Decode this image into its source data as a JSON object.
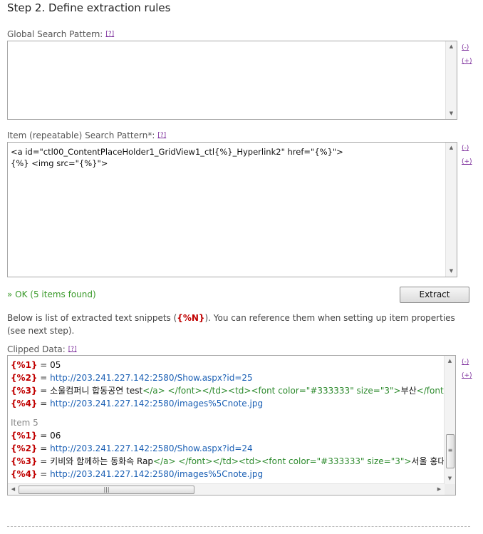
{
  "step_title": "Step 2. Define extraction rules",
  "help_link": "[?]",
  "global_pattern": {
    "label": "Global Search Pattern:",
    "value": ""
  },
  "item_pattern": {
    "label": "Item (repeatable) Search Pattern*:",
    "line1": "<a id=\"ctl00_ContentPlaceHolder1_GridView1_ctl{%}_Hyperlink2\" href=\"{%}\">",
    "line2": "{%} <img src=\"{%}\">"
  },
  "side_links": {
    "collapse": "(-)",
    "expand": "(+)"
  },
  "status": "» OK (5 items found)",
  "extract_button": "Extract",
  "description": {
    "before": "Below is list of extracted text snippets (",
    "ref": "{%N}",
    "after": "). You can reference them when setting up item properties (see next step)."
  },
  "clipped": {
    "label": "Clipped Data:",
    "eq": " = ",
    "lines": [
      {
        "var": "{%1}",
        "value": "05"
      },
      {
        "var": "{%2}",
        "value": "http://203.241.227.142:2580/Show.aspx?id=25"
      },
      {
        "var": "{%3}",
        "text": "소울컴퍼니 합동공연 test",
        "html": "</a>  </font></td><td><font color=\"#333333\" size=\"3\">",
        "tail": "부산",
        "html2": "</font><"
      },
      {
        "var": "{%4}",
        "value": "http://203.241.227.142:2580/images%5Cnote.jpg"
      },
      {
        "item_label": "Item 5"
      },
      {
        "var": "{%1}",
        "value": "06"
      },
      {
        "var": "{%2}",
        "value": "http://203.241.227.142:2580/Show.aspx?id=24"
      },
      {
        "var": "{%3}",
        "text": "키비와 함께하는 동화속 Rap",
        "html": "</a>  </font></td><td><font color=\"#333333\" size=\"3\">",
        "tail": "서울 홍대"
      },
      {
        "var": "{%4}",
        "value": "http://203.241.227.142:2580/images%5Cnote.jpg"
      }
    ]
  },
  "scroll_glyphs": {
    "up": "▲",
    "down": "▼",
    "left": "◀",
    "right": "▶",
    "grip_v": "≡",
    "grip_h": "|||"
  }
}
